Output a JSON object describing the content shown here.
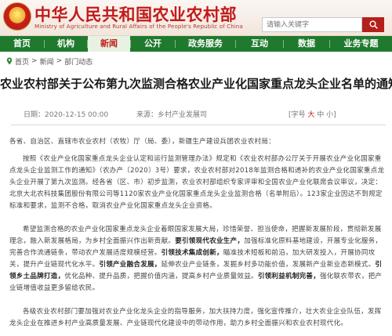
{
  "header": {
    "title": "中华人民共和国农业农村部",
    "subtitle": "Ministry of Agriculture and Rural Affairs of the People's Republic of China",
    "search_placeholder": "请输入关键字"
  },
  "nav": {
    "items": [
      {
        "label": "首页",
        "active": false
      },
      {
        "label": "机构",
        "active": false
      },
      {
        "label": "新闻",
        "active": true
      },
      {
        "label": "公开",
        "active": false
      },
      {
        "label": "政务服务",
        "active": false
      },
      {
        "label": "互动",
        "active": false
      },
      {
        "label": "数据",
        "active": false
      },
      {
        "label": "业务专题",
        "active": false
      }
    ]
  },
  "breadcrumb": {
    "sep": ">",
    "items": [
      "首页",
      "新闻",
      "部门动态"
    ]
  },
  "article": {
    "title": "农业农村部关于公布第九次监测合格农业产业化国家重点龙头企业名单的通知",
    "date": "日期：2020-12-15 00:00",
    "source": "来源：乡村产业发展司",
    "font_label": "[字号",
    "font_large": "大",
    "font_medium": "中",
    "font_small": "小]",
    "salutation": "各省、自治区、直辖市农业农村（农牧）厅（局、委），新疆生产建设兵团农业农村局：",
    "para1": "按照《农业产业化国家重点龙头企业认定和运行监测管理办法》规定和《农业农村部办公厅关于开展农业产业化国家重点龙头企业监测工作的通知》（农办产〔2020〕3号）要求，农业农村部对2018年监测合格和递补的农业产业化国家重点龙头企业开展了第九次监测。经各省（区、市）初步监测，农业农村部组织专家评审和全国农业产业化联席会议审议，决定：北京大北农科技集团股份有限公司等1120家农业产业化国家重点龙头企业监测合格（名单附后）。123家企业因达不到规定标准和要求，监测不合格，取消农业产业化国家重点龙头企业资格。",
    "para2_a": "希望监测合格的农业产业化国家重点龙头企业着眼国家发展大局，珍惜荣誉、担当使命，把握新发展阶段，贯彻新发展理念，融入新发展格局，为乡村全面振兴作出新贡献。",
    "para2_b": "要引领现代农业生产，",
    "para2_c": "加强标准化原料基地建设，开展专业化服务，完善合作流通链条，带动农户发展适度规模经营。",
    "para2_d": "引领技术集成创新，",
    "para2_e": "瞄准技术短板和前沿，加大研发投入，开展协同攻关，提升产业链现代化水平。",
    "para2_f": "引领产业融合发展，",
    "para2_g": "延伸农业产业链条，发掘乡村多功能价值，发展新产业新业态新模式。",
    "para2_h": "引领乡土品牌打造，",
    "para2_i": "优化品种、提升品质，把握价值内涵，提高乡村产业质量效益。",
    "para2_j": "引领利益机制完善，",
    "para2_k": "强化联农带农，把产业链增值收益更多留给农民。",
    "para3": "各级农业农村部门要加强对农业产业化龙头企业的指导服务，加大扶持力度，强化宣传推介，壮大农业企业队伍，发挥龙头企业在推进乡村产业高质量发展、产业链现代化建设中的带动作用，助力乡村全面振兴和农业农村现代化。"
  },
  "colors": {
    "brand_red": "#c21a1a",
    "nav_green": "#1f7a2e"
  }
}
